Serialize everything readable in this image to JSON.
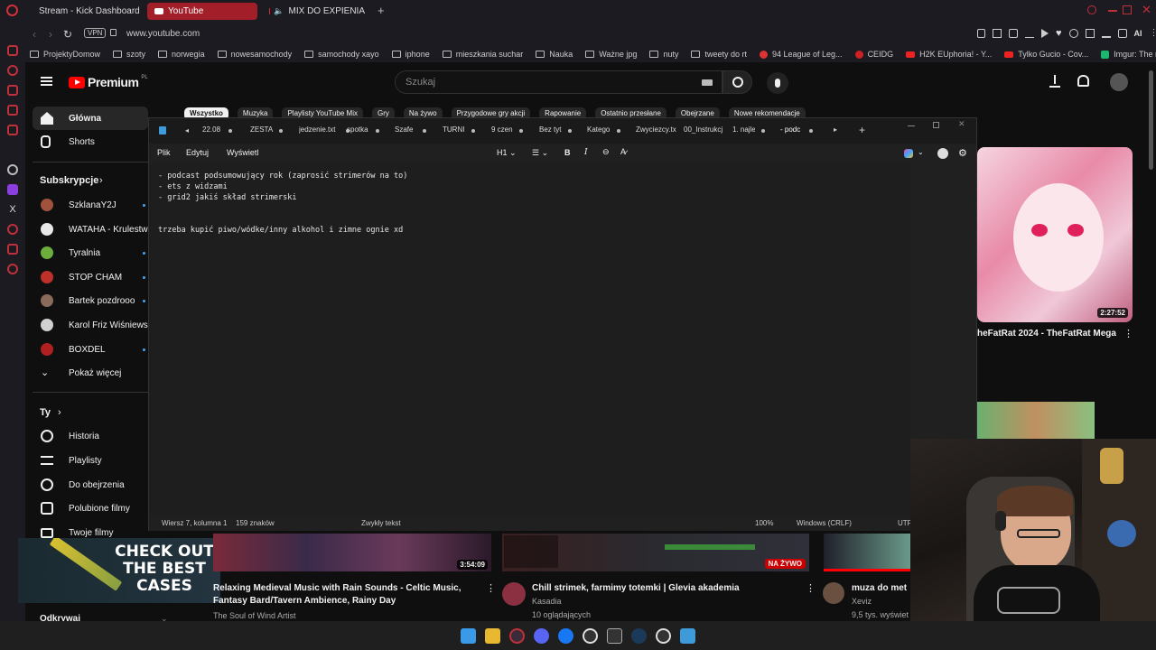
{
  "browser": {
    "tabs": [
      {
        "label": "Stream - Kick Dashboard"
      },
      {
        "label": "YouTube"
      },
      {
        "label": "MIX DO EXPIENIA"
      }
    ],
    "vpn_label": "VPN",
    "url": "www.youtube.com",
    "ai_label": "AI",
    "bookmarks": [
      "ProjektyDomow",
      "szoty",
      "norwegia",
      "nowesamochody",
      "samochody xayo",
      "iphone",
      "mieszkania suchar",
      "Nauka",
      "Ważne jpg",
      "nuty",
      "tweety do rt",
      "94 League of Leg...",
      "CEIDG",
      "H2K EUphoria! - Y...",
      "Tylko Gucio - Cov...",
      "Imgur: The most a..."
    ]
  },
  "youtube": {
    "logo_text": "Premium",
    "logo_region": "PL",
    "search_placeholder": "Szukaj",
    "chips": [
      "Wszystko",
      "Muzyka",
      "Playlisty YouTube Mix",
      "Gry",
      "Na żywo",
      "Przygodowe gry akcji",
      "Rapowanie",
      "Ostatnio przesłane",
      "Obejrzane",
      "Nowe rekomendacje"
    ],
    "sidebar": {
      "main": [
        {
          "label": "Główna"
        },
        {
          "label": "Shorts"
        }
      ],
      "subs_header": "Subskrypcje",
      "subs": [
        {
          "label": "SzklanaY2J",
          "color": "#a0523d"
        },
        {
          "label": "WATAHA - Krulestwo",
          "color": "#e8e8e8"
        },
        {
          "label": "Tyralnia",
          "color": "#6cae3c"
        },
        {
          "label": "STOP CHAM",
          "color": "#c0302a"
        },
        {
          "label": "Bartek pozdrooo",
          "color": "#8a6a5a"
        },
        {
          "label": "Karol Friz Wiśniewski",
          "color": "#d0d0d0"
        },
        {
          "label": "BOXDEL",
          "color": "#b02020"
        }
      ],
      "show_more": "Pokaż więcej",
      "you_header": "Ty",
      "you_items": [
        {
          "label": "Historia"
        },
        {
          "label": "Playlisty"
        },
        {
          "label": "Do obejrzenia"
        },
        {
          "label": "Polubione filmy"
        },
        {
          "label": "Twoje filmy"
        }
      ],
      "explore": "Odkrywaj"
    },
    "right_video": {
      "duration": "2:27:52",
      "title": "heFatRat 2024 - TheFatRat Mega"
    },
    "bottom_videos": [
      {
        "duration": "3:54:09",
        "title": "Relaxing Medieval Music with Rain Sounds - Celtic Music, Fantasy Bard/Tavern Ambience, Rainy Day",
        "channel": "The Soul of Wind Artist"
      },
      {
        "live": "NA ŻYWO",
        "title": "Chill strimek, farmimy totemki | Glevia akademia",
        "channel": "Kasadia",
        "views": "10 oglądających"
      },
      {
        "title": "muza do met",
        "channel": "Xeviz",
        "views": "9,5 tys. wyświet"
      }
    ],
    "ad_text": [
      "CHECK OUT",
      "THE BEST",
      "CASES"
    ]
  },
  "notepad": {
    "tabs": [
      "22.08 r",
      "ZESTA",
      "jedzenie.txt",
      "spotka",
      "Szafe",
      "TURNI",
      "9 czen",
      "Bez tyt",
      "Katego",
      "Zwyciezcy.tx",
      "00_Instrukcj",
      "1. najle",
      "- podc"
    ],
    "menu": [
      "Plik",
      "Edytuj",
      "Wyświetl"
    ],
    "heading_label": "H1",
    "content": "- podcast podsumowujący rok (zaprosić strimerów na to)\n- ets z widzami\n- grid2 jakiś skład strimerski\n\n\ntrzeba kupić piwo/wódke/inny alkohol i zimne ognie xd",
    "status": {
      "position": "Wiersz 7, kolumna 1",
      "chars": "159 znaków",
      "format": "Zwykły tekst",
      "zoom": "100%",
      "line_endings": "Windows (CRLF)",
      "encoding": "UTF"
    }
  }
}
